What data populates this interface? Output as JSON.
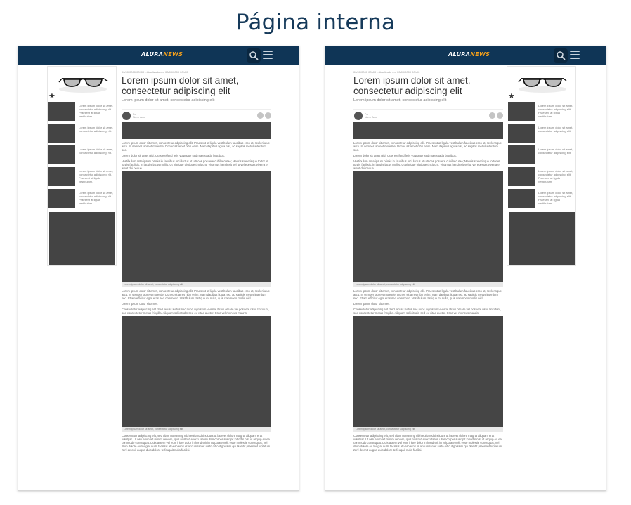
{
  "heading": "Página interna",
  "colors": {
    "header_bg": "#0f3556",
    "logo_accent": "#f7a11a",
    "heading": "#163a5a",
    "placeholder": "#454545"
  },
  "header": {
    "logo_part1": "ALURA",
    "logo_part2": "NEWS",
    "icons": [
      "search-icon",
      "hamburger-menu-icon"
    ]
  },
  "sidebar": {
    "feature_image": "glasses-image",
    "favorite_icon": "star-icon",
    "items": [
      {
        "text": "Lorem ipsum dolor sit amet, consectetur adipiscing elit. Praesent at ligula vestibulum."
      },
      {
        "text": "Lorem ipsum dolor sit amet, consectetur adipiscing elit."
      },
      {
        "text": "Lorem ipsum dolor sit amet, consectetur adipiscing elit."
      },
      {
        "text": "Lorem ipsum dolor sit amet, consectetur adipiscing elit. Praesent at ligula vestibulum."
      },
      {
        "text": "Lorem ipsum dolor sit amet, consectetur adipiscing elit. Praesent at ligula vestibulum."
      }
    ]
  },
  "article": {
    "meta": "00/00/0000 00h00 - Atualizado em 00/00/0000 00h00",
    "title": "Lorem ipsum dolor sit amet, consectetur adipiscing elit",
    "subtitle": "Lorem ipsum dolor sit amet, consectetur adipiscing elit",
    "author_name": "Por",
    "author_role": "Nome Autor",
    "share_icons": [
      "facebook-icon",
      "twitter-icon"
    ],
    "paragraphs": [
      "Lorem ipsum dolor sit amet, consectetur adipiscing elit. Praesent at ligula vestibulum faucibus eros at, scelerisque arcu. In semper laoreet molestie. Donec sit amet nibh enim. Nam dapibus ligula nisl, ac sagittis metus interdum sed.",
      "Lorem dolor sit amet nisi. Cras eleifend felis vulputate sed malesuada faucibus.",
      "Vestibulum ante ipsum primis in faucibus orci luctus et ultrices posuere cubilia curae; Mauris scelerisque tortor et turpis facilisis, in iaculis lacus mollis. Ut tristique tristique tincidunt. Vivamus hendrerit vel ut vel egestas viverra et amet dui neque.",
      "Lorem ipsum dolor sit amet, consectetur adipiscing elit. Praesent at ligula vestibulum faucibus eros at, scelerisque arcu. In semper laoreet molestie. Donec sit amet nibh enim. Nam dapibus ligula nisl, ac sagittis metus interdum sed. Etiam efficitur eget eros sed commodo. Vestibulum tristique mi nulla, quis commodo mollis nisl.",
      "Lorem ipsum dolor sit amet.",
      "Consectetur adipiscing elit. Sed iaculis lectus nec nunc dignissim viverra. Proin ornare vel posuere risus tincidunt, sed consectetur metus fringilla. Aliquam sollicitudin sed ex vitae auctor. Cras vel rhoncus mauris.",
      "Consectetur adipiscing elit, sed diam nonummy nibh euismod tincidunt ut laoreet dolore magna aliquam erat volutpat. Ut wisi enim ad minim veniam, quis nostrud exerci tation ullamcorper suscipit lobortis nisl ut aliquip ex ea commodo consequat. Duis autem vel eum iriure dolor in hendrerit in vulputate velit esse molestie consequat, vel illum dolore eu feugiat nulla facilisis at vero eros et accumsan et iusto odio dignissim qui blandit praesent luptatum zzril delenit augue duis dolore te feugait nulla facilisi."
    ],
    "caption": "Lorem ipsum dolor sit amet, consectetur adipiscing elit"
  }
}
